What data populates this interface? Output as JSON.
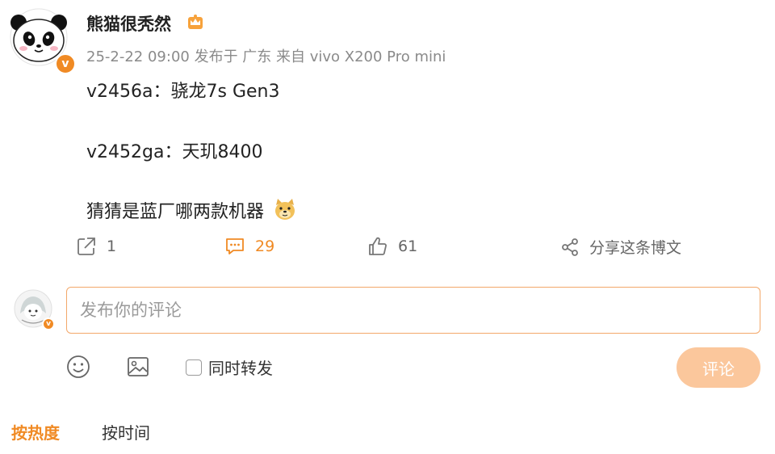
{
  "post": {
    "author": {
      "name": "熊猫很秃然",
      "avatar_icon": "panda-avatar",
      "verified_badge": "v-badge-icon",
      "member_icon": "crown-icon"
    },
    "meta": "25-2-22 09:00 发布于 广东 来自 vivo X200 Pro mini",
    "content": {
      "line1": "v2456a：骁龙7s Gen3",
      "line2": "v2452ga：天玑8400",
      "line3": "猜猜是蓝厂哪两款机器",
      "emoji": "doge-emoji"
    },
    "actions": {
      "repost_count": "1",
      "comment_count": "29",
      "like_count": "61",
      "share_label": "分享这条博文"
    }
  },
  "composer": {
    "placeholder": "发布你的评论",
    "value": "",
    "repost_label": "同时转发",
    "submit_label": "评论"
  },
  "sort": {
    "hot_label": "按热度",
    "time_label": "按时间"
  },
  "colors": {
    "accent": "#f08a24",
    "submit_disabled": "#fbc79c",
    "input_border": "#f3a86a"
  }
}
